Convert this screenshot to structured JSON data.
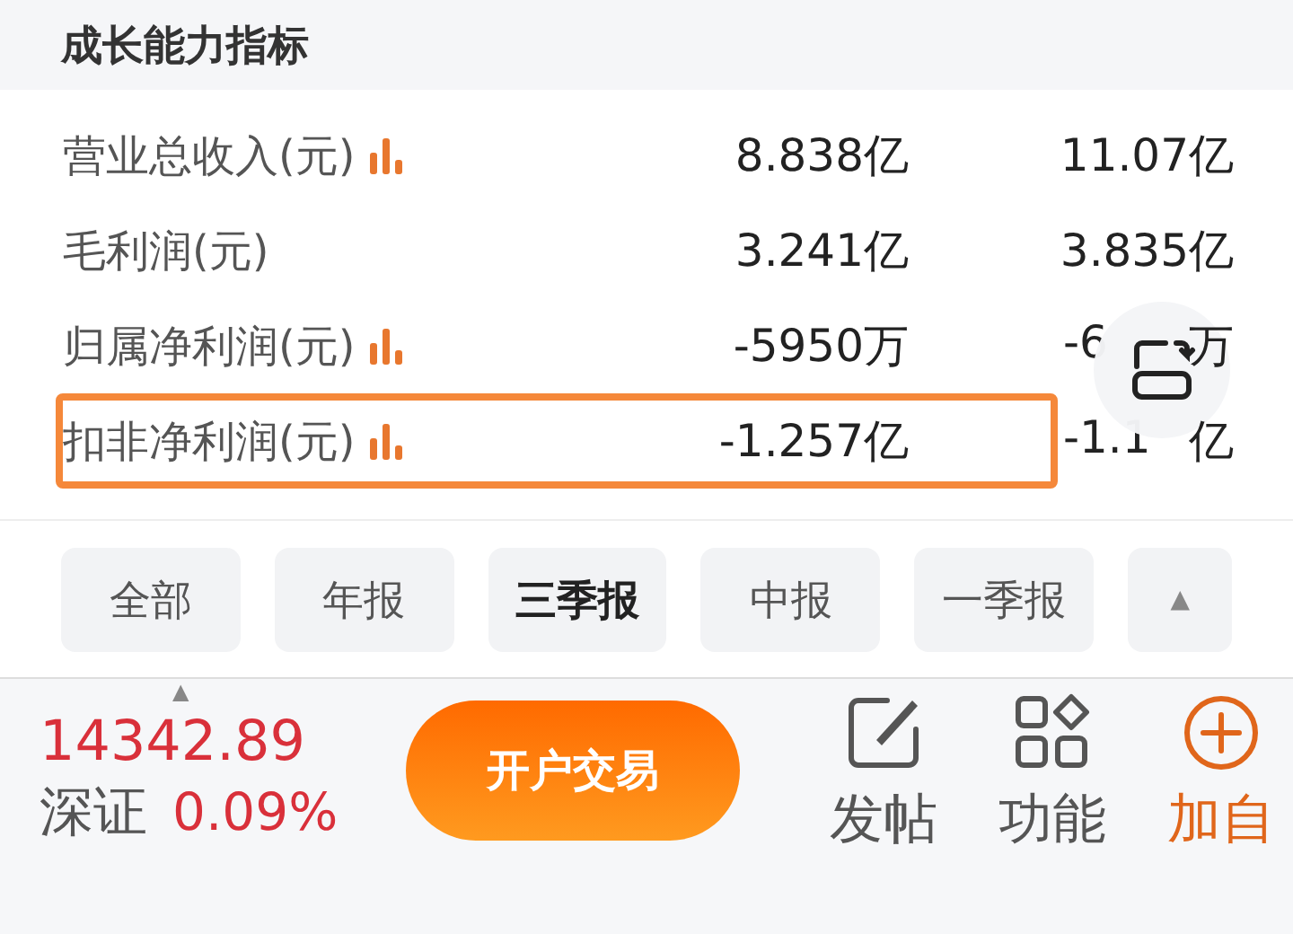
{
  "section": {
    "title": "成长能力指标"
  },
  "rows": [
    {
      "label": "营业总收入(元)",
      "chart_icon": true,
      "highlighted": false,
      "values": [
        {
          "text": "8.838亿"
        },
        {
          "text": "11.07亿"
        }
      ]
    },
    {
      "label": "毛利润(元)",
      "chart_icon": false,
      "highlighted": false,
      "values": [
        {
          "text": "3.241亿"
        },
        {
          "text": "3.835亿"
        }
      ]
    },
    {
      "label": "归属净利润(元)",
      "chart_icon": true,
      "highlighted": false,
      "values": [
        {
          "text": "-5950万"
        },
        {
          "text": "-6",
          "tail": "万"
        }
      ]
    },
    {
      "label": "扣非净利润(元)",
      "chart_icon": true,
      "highlighted": true,
      "values": [
        {
          "text": "-1.257亿"
        },
        {
          "text": "-1.1",
          "tail": "亿"
        }
      ]
    }
  ],
  "period_tabs": [
    {
      "label": "全部",
      "selected": false
    },
    {
      "label": "年报",
      "selected": false
    },
    {
      "label": "三季报",
      "selected": true
    },
    {
      "label": "中报",
      "selected": false
    },
    {
      "label": "一季报",
      "selected": false
    }
  ],
  "collapse_button": {
    "label": "▲"
  },
  "quote": {
    "caret": "▲",
    "price": "14342.89",
    "name": "深证",
    "change": "0.09%"
  },
  "trade_button": {
    "label": "开户交易"
  },
  "actions": [
    {
      "kind": "post",
      "label": "发帖",
      "accent": false
    },
    {
      "kind": "functions",
      "label": "功能",
      "accent": false
    },
    {
      "kind": "add",
      "label": "加自",
      "accent": true
    }
  ]
}
